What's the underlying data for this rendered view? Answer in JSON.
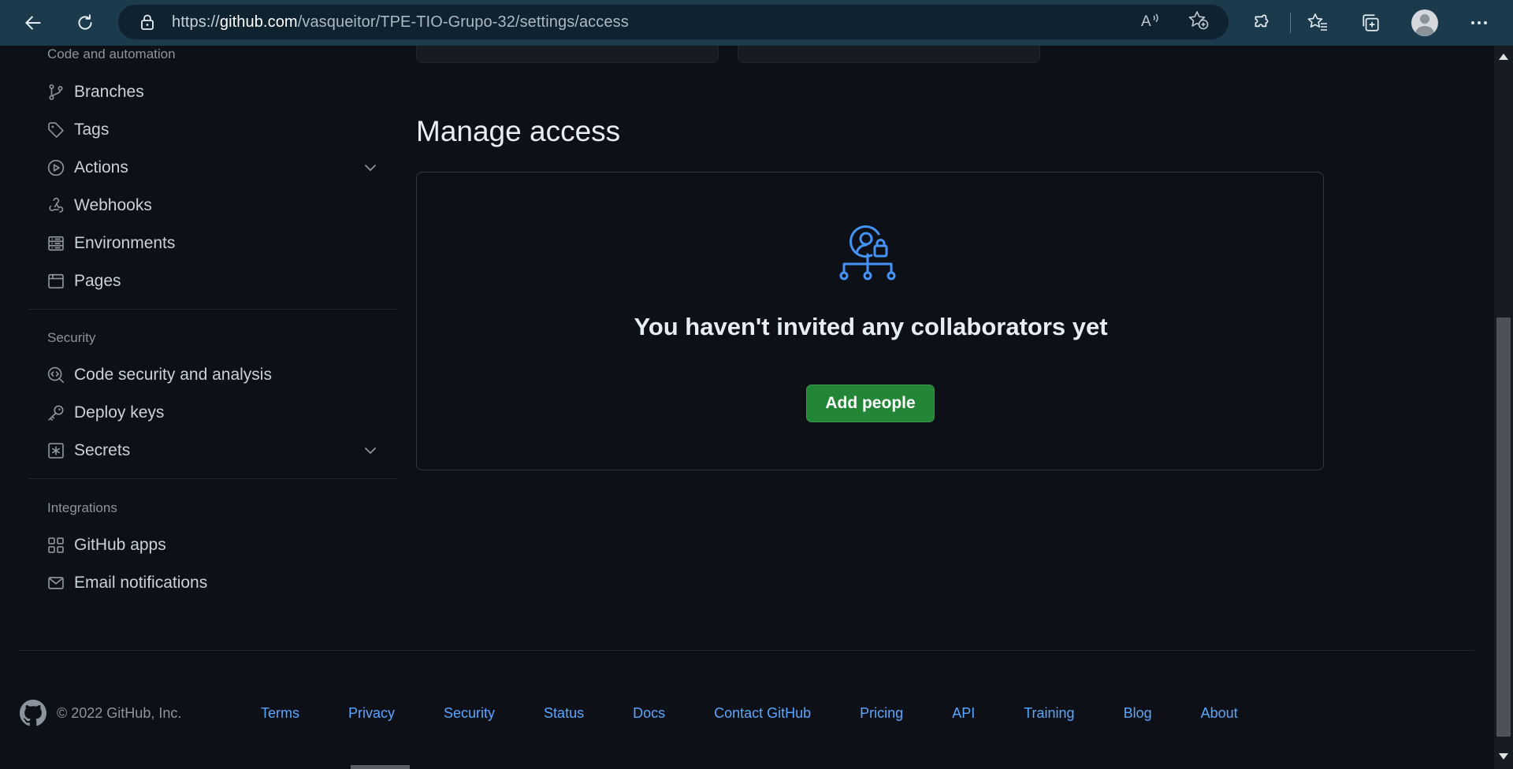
{
  "browser": {
    "url_prefix": "https://",
    "url_host": "github.com",
    "url_path": "/vasqueitor/TPE-TIO-Grupo-32/settings/access"
  },
  "sidebar": {
    "code_section": {
      "title": "Code and automation",
      "items": [
        {
          "label": "Branches",
          "icon": "git-branch-icon"
        },
        {
          "label": "Tags",
          "icon": "tag-icon"
        },
        {
          "label": "Actions",
          "icon": "play-icon",
          "expandable": true
        },
        {
          "label": "Webhooks",
          "icon": "webhook-icon"
        },
        {
          "label": "Environments",
          "icon": "server-icon"
        },
        {
          "label": "Pages",
          "icon": "browser-icon"
        }
      ]
    },
    "security_section": {
      "title": "Security",
      "items": [
        {
          "label": "Code security and analysis",
          "icon": "codescan-icon"
        },
        {
          "label": "Deploy keys",
          "icon": "key-icon"
        },
        {
          "label": "Secrets",
          "icon": "asterisk-icon",
          "expandable": true
        }
      ]
    },
    "integrations_section": {
      "title": "Integrations",
      "items": [
        {
          "label": "GitHub apps",
          "icon": "apps-icon"
        },
        {
          "label": "Email notifications",
          "icon": "mail-icon"
        }
      ]
    }
  },
  "main": {
    "title": "Manage access",
    "empty_message": "You haven't invited any collaborators yet",
    "add_button_label": "Add people"
  },
  "footer": {
    "copyright": "© 2022 GitHub, Inc.",
    "links": [
      "Terms",
      "Privacy",
      "Security",
      "Status",
      "Docs",
      "Contact GitHub",
      "Pricing",
      "API",
      "Training",
      "Blog",
      "About"
    ]
  },
  "colors": {
    "background": "#0d1117",
    "accent_link": "#58a6ff",
    "button_green": "#238636",
    "icon_blue": "#4493f8",
    "browser_chrome": "#1b3a4b"
  }
}
